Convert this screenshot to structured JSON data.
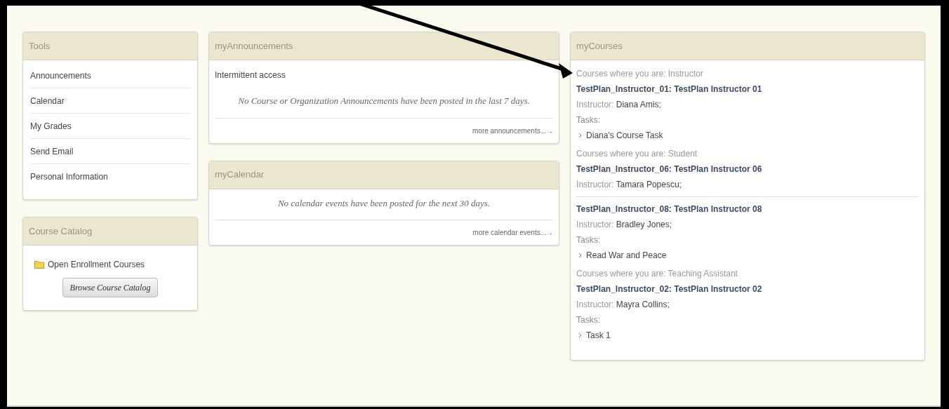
{
  "tools": {
    "title": "Tools",
    "items": [
      "Announcements",
      "Calendar",
      "My Grades",
      "Send Email",
      "Personal Information"
    ]
  },
  "course_catalog": {
    "title": "Course Catalog",
    "folder_link": "Open Enrollment Courses",
    "button": "Browse Course Catalog"
  },
  "announcements": {
    "title": "myAnnouncements",
    "subtitle": "Intermittent access",
    "message": "No Course or Organization Announcements have been posted in the last 7 days.",
    "more_link": "more announcements...→"
  },
  "calendar": {
    "title": "myCalendar",
    "message": "No calendar events have been posted for the next 30 days.",
    "more_link": "more calendar events...→"
  },
  "courses": {
    "title": "myCourses",
    "groups": [
      {
        "label": "Courses where you are: Instructor",
        "courses": [
          {
            "title": "TestPlan_Instructor_01: TestPlan Instructor 01",
            "instructor_label": "Instructor:",
            "instructor": "Diana Amis;",
            "tasks_label": "Tasks:",
            "tasks": [
              "Diana's Course Task"
            ]
          }
        ]
      },
      {
        "label": "Courses where you are: Student",
        "courses": [
          {
            "title": "TestPlan_Instructor_06: TestPlan Instructor 06",
            "instructor_label": "Instructor:",
            "instructor": "Tamara Popescu;"
          },
          {
            "title": "TestPlan_Instructor_08: TestPlan Instructor 08",
            "instructor_label": "Instructor:",
            "instructor": "Bradley Jones;",
            "tasks_label": "Tasks:",
            "tasks": [
              "Read War and Peace"
            ]
          }
        ]
      },
      {
        "label": "Courses where you are: Teaching Assistant",
        "courses": [
          {
            "title": "TestPlan_Instructor_02: TestPlan Instructor 02",
            "instructor_label": "Instructor:",
            "instructor": "Mayra Collins;",
            "tasks_label": "Tasks:",
            "tasks": [
              "Task 1"
            ]
          }
        ]
      }
    ]
  }
}
